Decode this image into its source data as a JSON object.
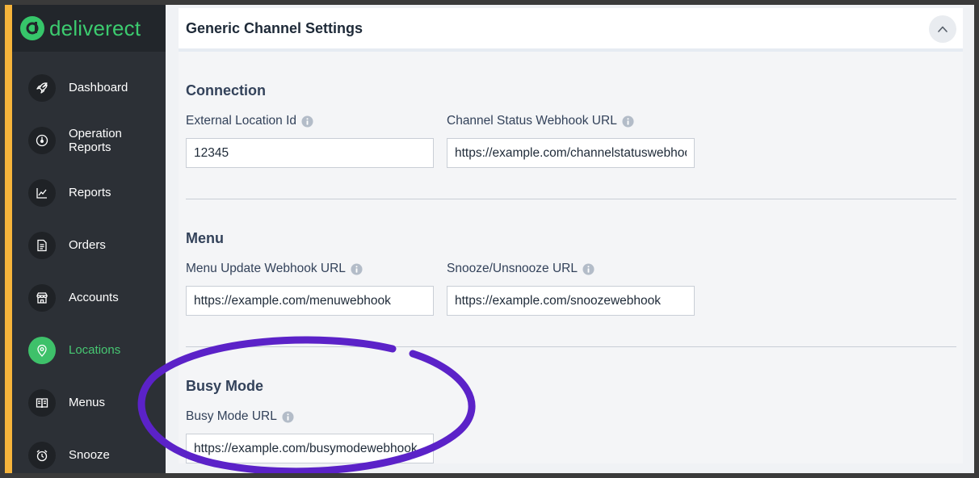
{
  "brand": {
    "name": "deliverect"
  },
  "colors": {
    "accent": "#f6b43b",
    "brand_green": "#3ec16a",
    "annotation": "#5b22c8"
  },
  "sidebar": {
    "items": [
      {
        "label": "Dashboard",
        "icon": "rocket-icon",
        "active": false
      },
      {
        "label": "Operation\nReports",
        "icon": "gauge-icon",
        "active": false
      },
      {
        "label": "Reports",
        "icon": "chart-line-icon",
        "active": false
      },
      {
        "label": "Orders",
        "icon": "document-icon",
        "active": false
      },
      {
        "label": "Accounts",
        "icon": "store-icon",
        "active": false
      },
      {
        "label": "Locations",
        "icon": "map-pin-icon",
        "active": true
      },
      {
        "label": "Menus",
        "icon": "book-icon",
        "active": false
      },
      {
        "label": "Snooze",
        "icon": "alarm-clock-icon",
        "active": false
      }
    ]
  },
  "panel": {
    "title": "Generic Channel Settings",
    "sections": {
      "connection": {
        "title": "Connection",
        "external_location_id": {
          "label": "External Location Id",
          "value": "12345"
        },
        "channel_status_webhook": {
          "label": "Channel Status Webhook URL",
          "value": "https://example.com/channelstatuswebhook"
        }
      },
      "menu": {
        "title": "Menu",
        "menu_update_webhook": {
          "label": "Menu Update Webhook URL",
          "value": "https://example.com/menuwebhook"
        },
        "snooze_url": {
          "label": "Snooze/Unsnooze URL",
          "value": "https://example.com/snoozewebhook"
        }
      },
      "busy_mode": {
        "title": "Busy Mode",
        "busy_mode_url": {
          "label": "Busy Mode URL",
          "value": "https://example.com/busymodewebhook"
        }
      }
    }
  }
}
